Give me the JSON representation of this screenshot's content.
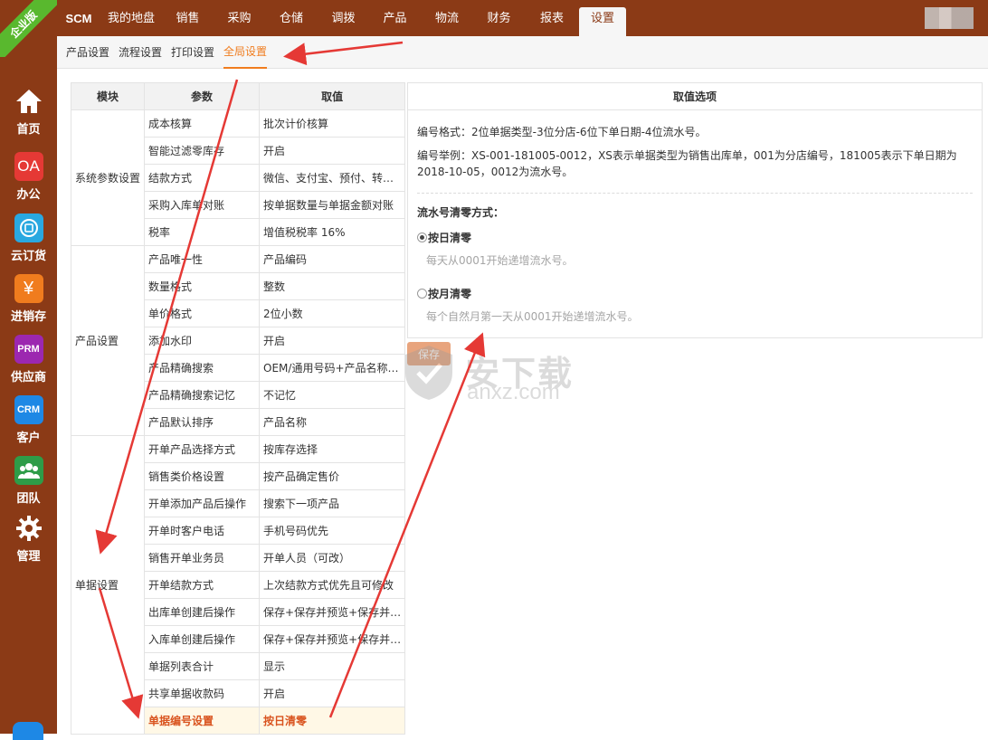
{
  "edition_badge": "企业版",
  "sidebar": {
    "items": [
      {
        "label": "首页",
        "icon": "home-icon",
        "color": "transparent",
        "glyph": "⌂"
      },
      {
        "label": "办公",
        "icon": "oa-icon",
        "color": "#e53935",
        "glyph": "OA"
      },
      {
        "label": "云订货",
        "icon": "cloud-order-icon",
        "color": "#29a8e0",
        "glyph": "◎"
      },
      {
        "label": "进销存",
        "icon": "yen-icon",
        "color": "#f07c1e",
        "glyph": "¥"
      },
      {
        "label": "供应商",
        "icon": "prm-icon",
        "color": "#9c27b0",
        "glyph": "PRM"
      },
      {
        "label": "客户",
        "icon": "crm-icon",
        "color": "#1e88e5",
        "glyph": "CRM"
      },
      {
        "label": "团队",
        "icon": "team-icon",
        "color": "#2e9c48",
        "glyph": "👥"
      },
      {
        "label": "管理",
        "icon": "gear-icon",
        "color": "transparent",
        "glyph": "⚙"
      }
    ]
  },
  "topnav": {
    "tabs": [
      {
        "label": "SCM",
        "brand": true
      },
      {
        "label": "我的地盘"
      },
      {
        "label": "销售"
      },
      {
        "label": "采购"
      },
      {
        "label": "仓储"
      },
      {
        "label": "调拨"
      },
      {
        "label": "产品"
      },
      {
        "label": "物流"
      },
      {
        "label": "财务"
      },
      {
        "label": "报表"
      },
      {
        "label": "设置",
        "active": true
      }
    ]
  },
  "subnav": {
    "tabs": [
      {
        "label": "产品设置"
      },
      {
        "label": "流程设置"
      },
      {
        "label": "打印设置"
      },
      {
        "label": "全局设置",
        "active": true
      }
    ]
  },
  "table": {
    "headers": [
      "模块",
      "参数",
      "取值"
    ],
    "groups": [
      {
        "module": "系统参数设置",
        "rows": [
          {
            "param": "成本核算",
            "value": "批次计价核算"
          },
          {
            "param": "智能过滤零库存",
            "value": "开启"
          },
          {
            "param": "结款方式",
            "value": "微信、支付宝、预付、转…"
          },
          {
            "param": "采购入库单对账",
            "value": "按单据数量与单据金额对账"
          },
          {
            "param": "税率",
            "value": "增值税税率 16%"
          }
        ]
      },
      {
        "module": "产品设置",
        "rows": [
          {
            "param": "产品唯一性",
            "value": "产品编码"
          },
          {
            "param": "数量格式",
            "value": "整数"
          },
          {
            "param": "单价格式",
            "value": "2位小数"
          },
          {
            "param": "添加水印",
            "value": "开启"
          },
          {
            "param": "产品精确搜索",
            "value": "OEM/通用号码+产品名称…"
          },
          {
            "param": "产品精确搜索记忆",
            "value": "不记忆"
          },
          {
            "param": "产品默认排序",
            "value": "产品名称"
          }
        ]
      },
      {
        "module": "单据设置",
        "rows": [
          {
            "param": "开单产品选择方式",
            "value": "按库存选择"
          },
          {
            "param": "销售类价格设置",
            "value": "按产品确定售价"
          },
          {
            "param": "开单添加产品后操作",
            "value": "搜索下一项产品"
          },
          {
            "param": "开单时客户电话",
            "value": "手机号码优先"
          },
          {
            "param": "销售开单业务员",
            "value": "开单人员（可改）"
          },
          {
            "param": "开单结款方式",
            "value": "上次结款方式优先且可修改"
          },
          {
            "param": "出库单创建后操作",
            "value": "保存+保存并预览+保存并…"
          },
          {
            "param": "入库单创建后操作",
            "value": "保存+保存并预览+保存并…"
          },
          {
            "param": "单据列表合计",
            "value": "显示"
          },
          {
            "param": "共享单据收款码",
            "value": "开启"
          },
          {
            "param": "单据编号设置",
            "value": "按日清零",
            "selected": true
          }
        ]
      }
    ]
  },
  "panel": {
    "title": "取值选项",
    "format_text": "编号格式：2位单据类型-3位分店-6位下单日期-4位流水号。",
    "example_text": "编号举例：XS-001-181005-0012，XS表示单据类型为销售出库单，001为分店编号，181005表示下单日期为2018-10-05，0012为流水号。",
    "reset_label": "流水号清零方式：",
    "options": [
      {
        "label": "按日清零",
        "hint": "每天从0001开始递增流水号。",
        "checked": true
      },
      {
        "label": "按月清零",
        "hint": "每个自然月第一天从0001开始递增流水号。",
        "checked": false
      }
    ]
  },
  "save_label": "保存",
  "watermark": {
    "text": "安下载",
    "url": "anxz.com"
  },
  "colors": {
    "brand": "#8b3a16",
    "accent": "#f07c1e",
    "annotation": "#e53935"
  }
}
